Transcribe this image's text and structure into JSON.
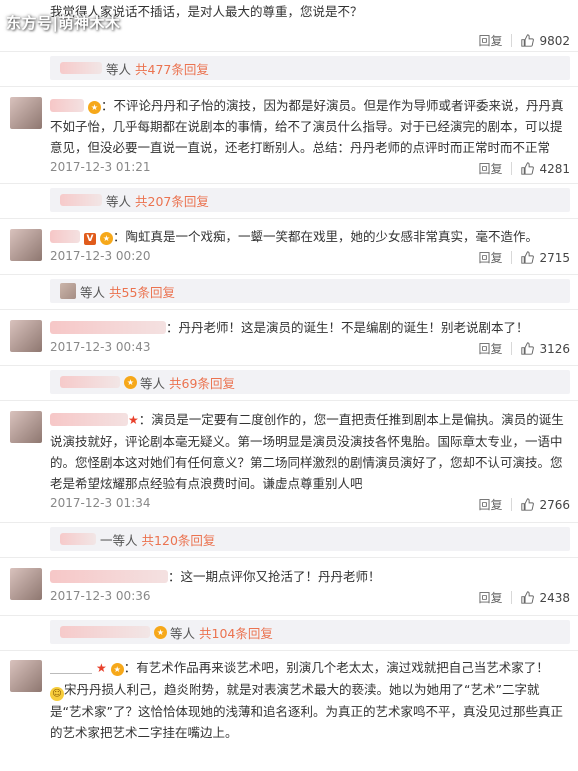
{
  "watermark": "东方号|萌神木木",
  "icons": {
    "like": "thumbs-up-icon",
    "vip": "vip-badge-icon",
    "medal": "medal-icon",
    "star": "star-icon",
    "emoji": "emoji-icon"
  },
  "colors": {
    "link": "#eb7350",
    "meta": "#888888",
    "subreply_bg": "#f2f2f5"
  },
  "labels": {
    "reply": "回复",
    "others": "等人",
    "total_prefix": "共",
    "total_suffix": "条回复"
  },
  "comments": [
    {
      "text": "我觉得人家说话不插话，是对人最大的尊重，您说是不？",
      "likes": "9802"
    },
    {
      "text": "不评论丹丹和子怡的演技，因为都是好演员。但是作为导师或者评委来说，丹丹真不如子怡，几乎每期都在说剧本的事情，给不了演员什么指导。对于已经演完的剧本，可以提意见，但没必要一直说一直说，还老打断别人。总结：丹丹老师的点评时而正常时而不正常",
      "time": "2017-12-3 01:21",
      "likes": "4281"
    },
    {
      "text": "陶虹真是一个戏痴，一颦一笑都在戏里，她的少女感非常真实，毫不造作。",
      "time": "2017-12-3 00:20",
      "likes": "2715"
    },
    {
      "text": "丹丹老师！这是演员的诞生！不是编剧的诞生！别老说剧本了！",
      "time": "2017-12-3 00:43",
      "likes": "3126"
    },
    {
      "text": "演员是一定要有二度创作的，您一直把责任推到剧本上是偏执。演员的诞生说演技就好，评论剧本毫无疑义。第一场明显是演员没演技各怀鬼胎。国际章太专业，一语中的。您怪剧本这对她们有任何意义？第二场同样激烈的剧情演员演好了，您却不认可演技。您老是希望炫耀那点经验有点浪费时间。谦虚点尊重别人吧",
      "time": "2017-12-3 01:34",
      "likes": "2766"
    },
    {
      "text": "这一期点评你又抢活了！丹丹老师！",
      "time": "2017-12-3 00:36",
      "likes": "2438"
    },
    {
      "text_line1": "有艺术作品再来谈艺术吧，别演几个老太太，演过戏就把自己当艺术家了！",
      "text_line2": "宋丹丹损人利己，趋炎附势，就是对表演艺术最大的亵渎。她以为她用了“艺术”二字就是“艺术家”了？这恰恰体现她的浅薄和追名逐利。为真正的艺术家鸣不平，真没见过那些真正的艺术家把艺术二字挂在嘴边上。"
    }
  ],
  "subreplies": [
    {
      "count": "477"
    },
    {
      "count": "207"
    },
    {
      "count": "55"
    },
    {
      "count": "69"
    },
    {
      "prefix": "一",
      "count": "120"
    },
    {
      "count": "104"
    }
  ]
}
